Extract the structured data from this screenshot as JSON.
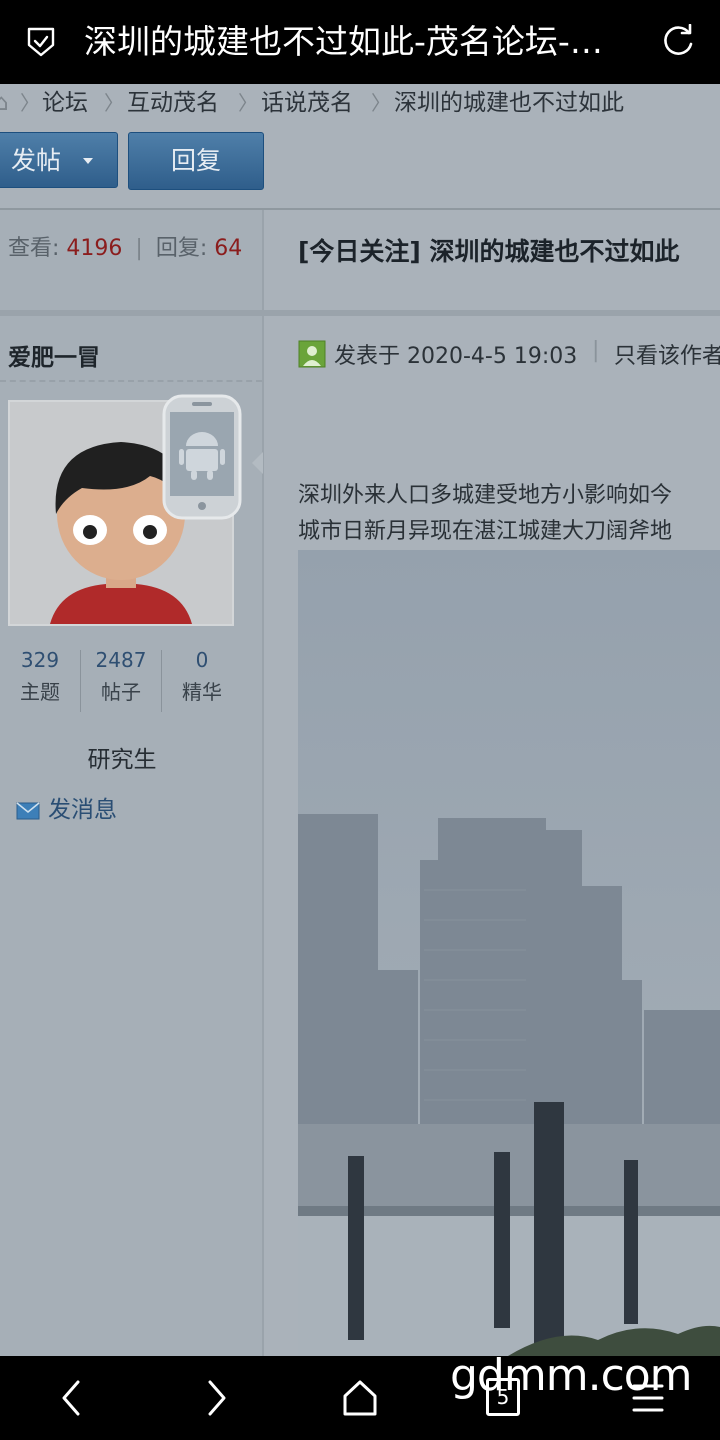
{
  "browser": {
    "title": "深圳的城建也不过如此-茂名论坛-话...",
    "tab_count": "5"
  },
  "breadcrumb": {
    "items": [
      "论坛",
      "互动茂名",
      "话说茂名",
      "深圳的城建也不过如此"
    ]
  },
  "toolbar": {
    "post_label": "发帖",
    "reply_label": "回复"
  },
  "stats": {
    "views_label": "查看:",
    "views": "4196",
    "replies_label": "回复:",
    "replies": "64"
  },
  "thread": {
    "title": "[今日关注] 深圳的城建也不过如此"
  },
  "author": {
    "name": "爱肥一冒",
    "counts": [
      {
        "value": "329",
        "label": "主题"
      },
      {
        "value": "2487",
        "label": "帖子"
      },
      {
        "value": "0",
        "label": "精华"
      }
    ],
    "rank": "研究生",
    "message_label": "发消息"
  },
  "post": {
    "posted_at": "发表于 2020-4-5 19:03",
    "only_author": "只看该作者",
    "body_lines": [
      "深圳外来人口多城建受地方小影响如今",
      "城市日新月异现在湛江城建大刀阔斧地"
    ]
  },
  "watermark": "gdmm.com",
  "colors": {
    "highlight_number": "#8b1d1d",
    "link": "#2a4e74",
    "button": "#3a6a96"
  }
}
